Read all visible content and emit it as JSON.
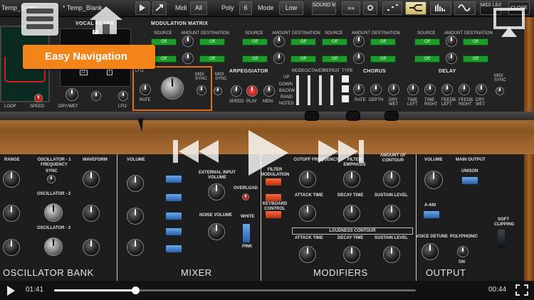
{
  "toolbar": {
    "preset1": "Temp_Synth",
    "preset2": "* Temp_Blank",
    "midi_label": "Midi",
    "midi_value": "All",
    "poly_label": "Poly",
    "poly_value": "6",
    "mode_label": "Mode",
    "mode_value": "Low",
    "sound_map": "SOUND MAP",
    "arrows": "»»",
    "midi_learn": "MIDI LEARN",
    "close": "CLOSE"
  },
  "callout": {
    "label": "Easy Navigation"
  },
  "top_panel": {
    "vocal_filter": "VOCAL FILTER",
    "vocal_letter": "A",
    "letter_o": "O",
    "letter_i": "I",
    "dry_wet": "DRY/WET",
    "lfo_small": "LFO",
    "loop": "LOOP",
    "speed": "SPEED",
    "modulation_matrix": "MODULATION MATRIX",
    "mm_source": "SOURCE",
    "mm_amount": "AMOUNT",
    "mm_destination": "DESTINATION",
    "mm_off": "Off",
    "lfo": "LFO",
    "rate": "RATE",
    "midi_sync": "MIDI SYNC",
    "arpeggiator": "ARPEGGIATOR",
    "arp_speed": "SPEED",
    "arp_play": "PLAY",
    "arp_mem": "MEM.",
    "arp_mode": "MODE",
    "arp_octaves": "OCTAVES",
    "arp_repeat": "REPEAT",
    "arp_up": "UP",
    "arp_down": "DOWN",
    "arp_backw": "BACKW",
    "arp_rand": "RAND",
    "arp_notes": "NOTES",
    "type": "TYPE",
    "chorus": "CHORUS",
    "chorus_rate": "RATE",
    "chorus_depth": "DEPTH",
    "chorus_drywet": "DRY WET",
    "delay": "DELAY",
    "delay_time_left": "TIME LEFT",
    "delay_time_right": "TIME RIGHT",
    "delay_feedb_left": "FEEDB. LEFT",
    "delay_feedb_right": "FEEDB. RIGHT",
    "delay_drywet": "DRY WET",
    "delay_midi_sync": "MIDI SYNC"
  },
  "bottom_panel": {
    "range": "RANGE",
    "osc1_freq": "OSCILLATOR - 1 FREQUENCY",
    "sync": "SYNC",
    "waveform": "WAVEFORM",
    "osc2": "OSCILLATOR - 2",
    "osc3": "OSCILLATOR - 3",
    "osc_bank": "OSCILLATOR BANK",
    "volume": "VOLUME",
    "ext_input": "EXTERNAL INPUT VOLUME",
    "overload": "OVERLOAD",
    "noise_volume": "NOISE VOLUME",
    "white": "WHITE",
    "pink": "PINK",
    "mixer": "MIXER",
    "filter_mod": "FILTER MODULATION",
    "keyboard_control": "KEYBOARD CONTROL",
    "cutoff": "CUTOFF FREQUENCY",
    "filter_emphasis": "FILTER EMPHASIS",
    "amount_contour": "AMOUNT OF CONTOUR",
    "attack_time": "ATTACK TIME",
    "decay_time": "DECAY TIME",
    "sustain_level": "SUSTAIN LEVEL",
    "loudness_contour": "LOUDNESS CONTOUR",
    "modifiers": "MODIFIERS",
    "out_volume": "VOLUME",
    "main_output": "MAIN OUTPUT",
    "unison": "UNISON",
    "a440": "A-440",
    "soft_clipping": "SOFT CLIPPING",
    "voice_detune": "VOICE DETUNE",
    "polyphonic": "POLYPHONIC",
    "on": "ON",
    "output": "OUTPUT"
  },
  "player": {
    "elapsed": "01:41",
    "remaining": "00:44",
    "progress": 0.225
  }
}
